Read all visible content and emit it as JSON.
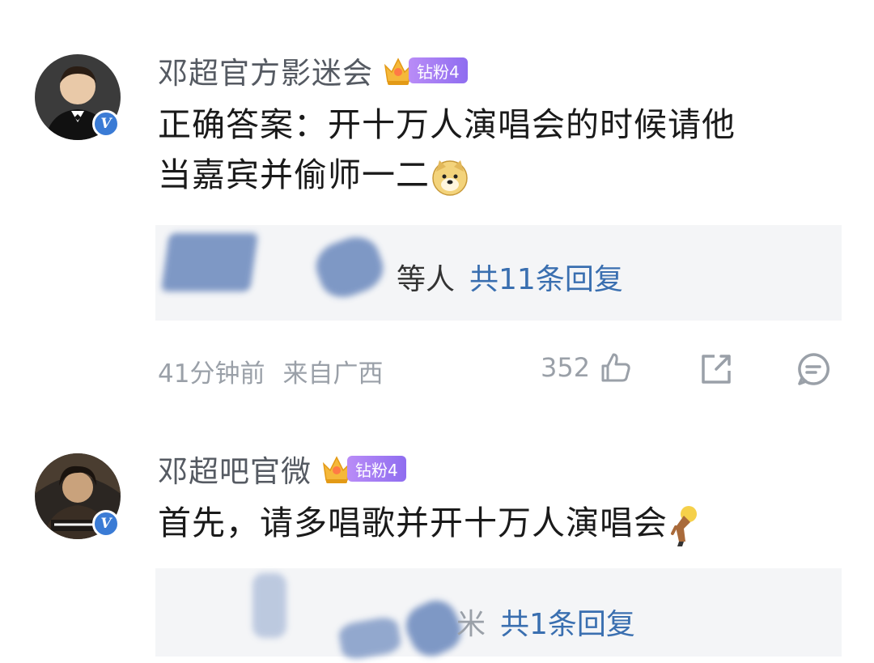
{
  "comments": [
    {
      "username": "邓超官方影迷会",
      "badge": "钻粉4",
      "text_line1": "正确答案：开十万人演唱会的时候请他",
      "text_line2": "当嘉宾并偷师一二",
      "emoji": "doge-emoji",
      "replies_names": "等人",
      "replies_count": "共11条回复",
      "time": "41分钟前",
      "location": "来自广西",
      "likes": "352"
    },
    {
      "username": "邓超吧官微",
      "badge": "钻粉4",
      "text_line1": "首先，请多唱歌并开十万人演唱会",
      "emoji": "bow-emoji",
      "replies_fragment": "米",
      "replies_count": "共1条回复"
    }
  ],
  "colors": {
    "accent_link": "#3a6fb0",
    "badge_purple": "#9a76f3",
    "verified_blue": "#3a7bd5",
    "meta_gray": "#9aa0a8",
    "reply_bg": "#f4f5f7"
  },
  "icons": [
    "like-icon",
    "share-icon",
    "comment-icon",
    "crown-icon",
    "verified-icon"
  ]
}
